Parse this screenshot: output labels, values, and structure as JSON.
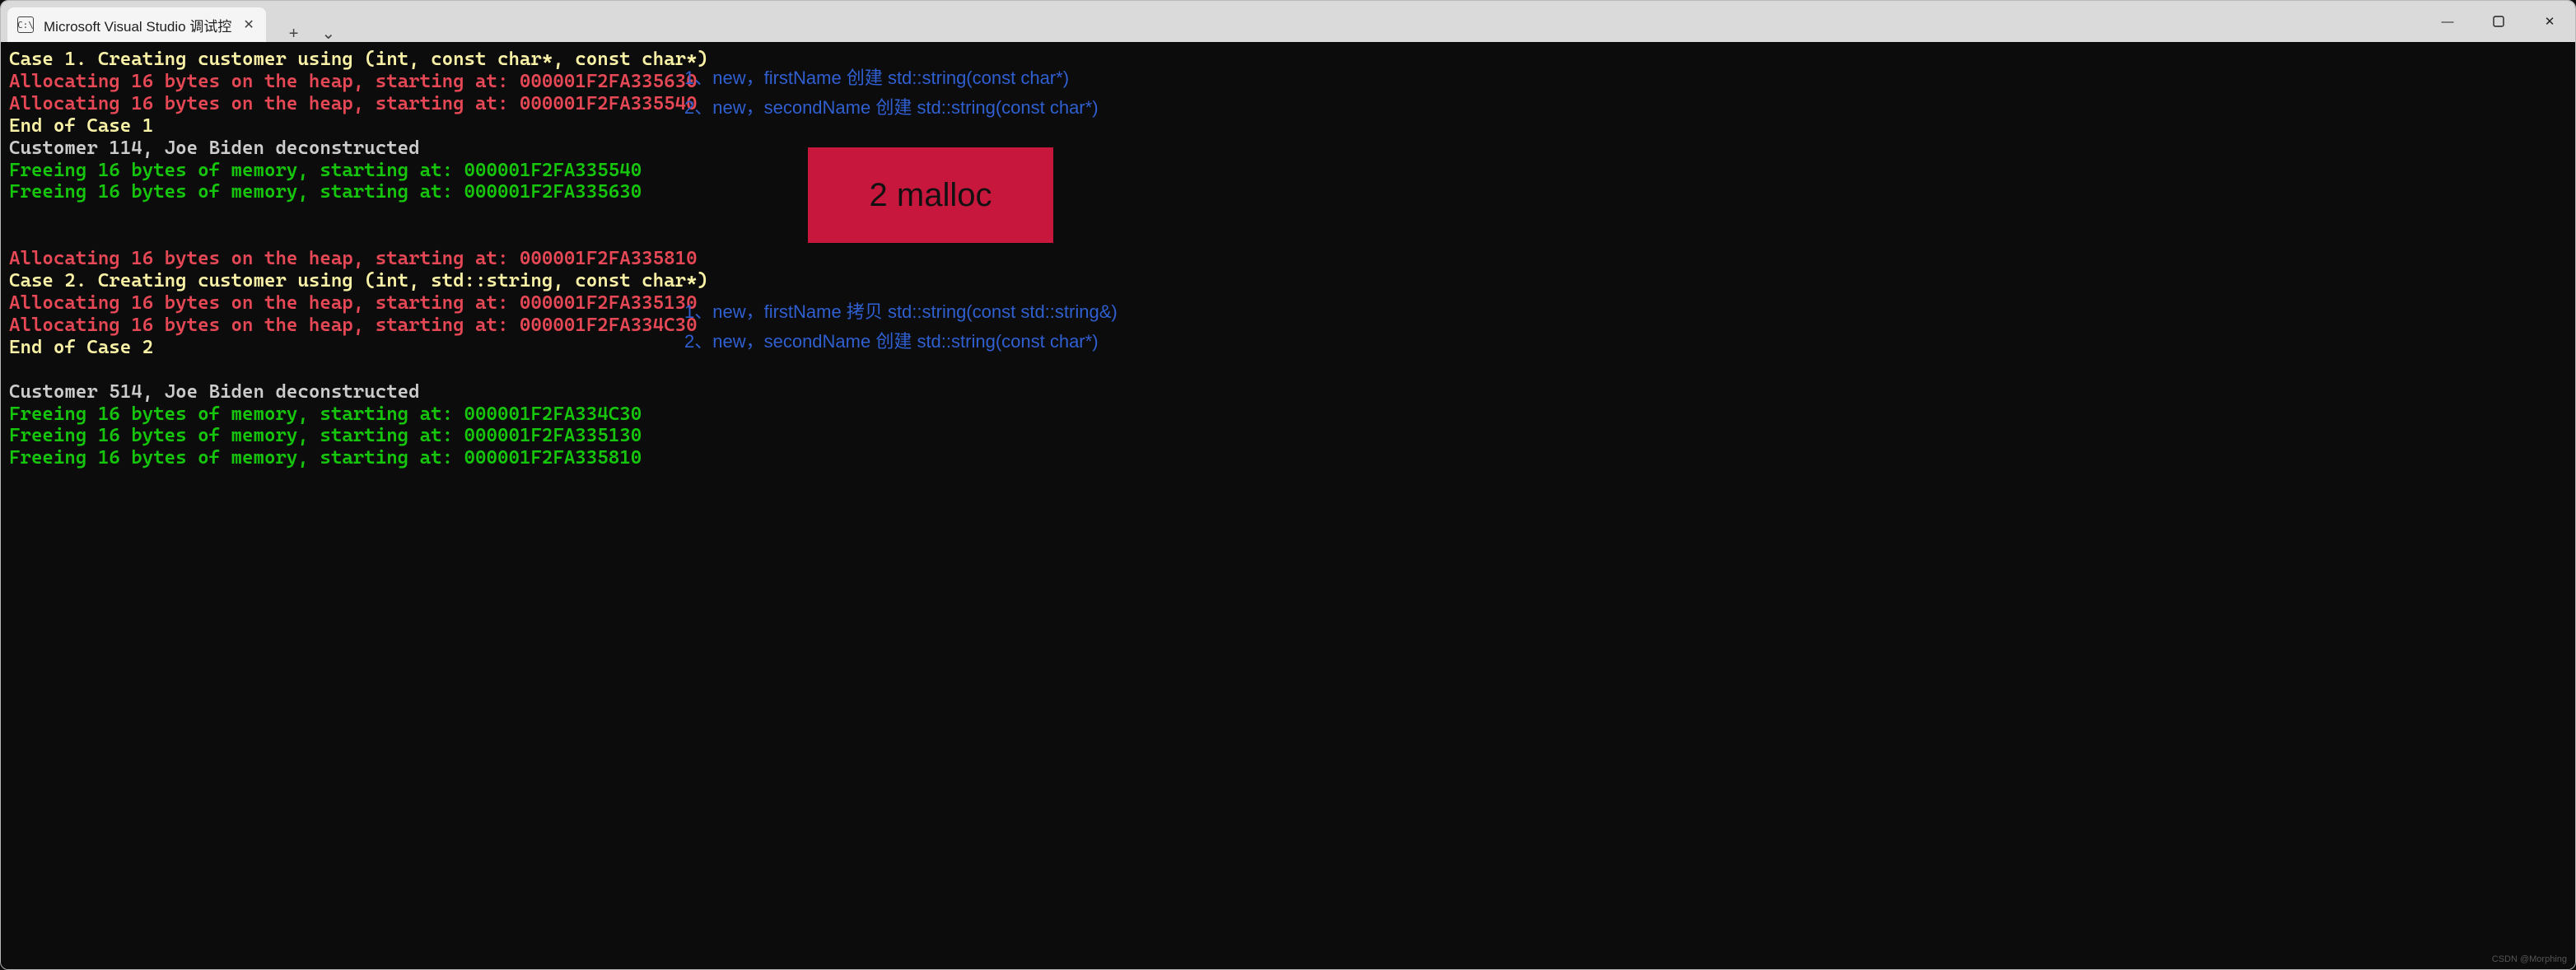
{
  "titlebar": {
    "tab_title": "Microsoft Visual Studio 调试控",
    "tab_icon_text": "C:\\",
    "new_tab_glyph": "+",
    "dropdown_glyph": "⌄",
    "minimize_glyph": "—",
    "close_glyph": "✕"
  },
  "terminal": {
    "lines": [
      {
        "cls": "c-yellow",
        "text": "Case 1. Creating customer using (int, const char*, const char*)"
      },
      {
        "cls": "c-red",
        "text": "Allocating 16 bytes on the heap, starting at: 000001F2FA335630"
      },
      {
        "cls": "c-red",
        "text": "Allocating 16 bytes on the heap, starting at: 000001F2FA335540"
      },
      {
        "cls": "c-yellow",
        "text": "End of Case 1"
      },
      {
        "cls": "c-white",
        "text": "Customer 114, Joe Biden deconstructed"
      },
      {
        "cls": "c-green",
        "text": "Freeing 16 bytes of memory, starting at: 000001F2FA335540"
      },
      {
        "cls": "c-green",
        "text": "Freeing 16 bytes of memory, starting at: 000001F2FA335630"
      },
      {
        "cls": "c-white",
        "text": ""
      },
      {
        "cls": "c-white",
        "text": ""
      },
      {
        "cls": "c-red",
        "text": "Allocating 16 bytes on the heap, starting at: 000001F2FA335810"
      },
      {
        "cls": "c-yellow",
        "text": "Case 2. Creating customer using (int, std::string, const char*)"
      },
      {
        "cls": "c-red",
        "text": "Allocating 16 bytes on the heap, starting at: 000001F2FA335130"
      },
      {
        "cls": "c-red",
        "text": "Allocating 16 bytes on the heap, starting at: 000001F2FA334C30"
      },
      {
        "cls": "c-yellow",
        "text": "End of Case 2"
      },
      {
        "cls": "c-white",
        "text": ""
      },
      {
        "cls": "c-white",
        "text": "Customer 514, Joe Biden deconstructed"
      },
      {
        "cls": "c-green",
        "text": "Freeing 16 bytes of memory, starting at: 000001F2FA334C30"
      },
      {
        "cls": "c-green",
        "text": "Freeing 16 bytes of memory, starting at: 000001F2FA335130"
      },
      {
        "cls": "c-green",
        "text": "Freeing 16 bytes of memory, starting at: 000001F2FA335810"
      }
    ]
  },
  "annotations": {
    "group1": [
      "1、new，firstName 创建 std::string(const char*)",
      "2、new，secondName 创建 std::string(const char*)"
    ],
    "group2": [
      "1、new，firstName 拷贝 std::string(const std::string&)",
      "2、new，secondName 创建 std::string(const char*)"
    ],
    "malloc_label": "2 malloc"
  },
  "watermark": "CSDN @Morphing"
}
